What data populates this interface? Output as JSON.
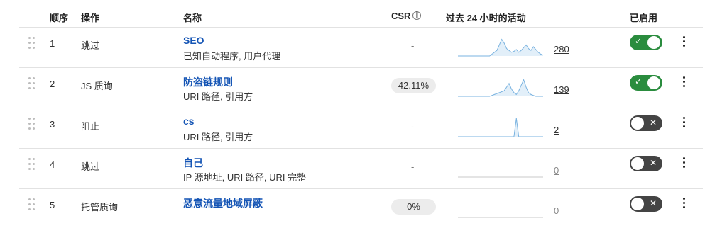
{
  "header": {
    "order": "顺序",
    "action": "操作",
    "name": "名称",
    "csr": "CSR",
    "csr_info_icon": "info-icon",
    "activity": "过去 24 小时的活动",
    "enabled": "已启用"
  },
  "colors": {
    "link": "#1555b5",
    "toggle_on": "#2a8c3e",
    "toggle_off": "#444444",
    "spark": "#7ab3e0"
  },
  "rows": [
    {
      "order": "1",
      "action": "跳过",
      "name": "SEO",
      "subtitle": "已知自动程序, 用户代理",
      "csr": "-",
      "csr_pill": false,
      "count": "280",
      "count_muted": false,
      "enabled": true,
      "enabled_mark": "✓",
      "activity": [
        0,
        0,
        0,
        0,
        0,
        0,
        0,
        0,
        0,
        0,
        0,
        0,
        0,
        0,
        0.1,
        0.2,
        0.3,
        0.6,
        0.9,
        0.7,
        0.4,
        0.3,
        0.2,
        0.25,
        0.35,
        0.2,
        0.3,
        0.45,
        0.6,
        0.4,
        0.3,
        0.5,
        0.35,
        0.2,
        0.1,
        0.05
      ]
    },
    {
      "order": "2",
      "action": "JS 质询",
      "name": "防盗链规则",
      "subtitle": "URI 路径, 引用方",
      "csr": "42.11%",
      "csr_pill": true,
      "count": "139",
      "count_muted": false,
      "enabled": true,
      "enabled_mark": "✓",
      "activity": [
        0,
        0,
        0,
        0,
        0,
        0,
        0,
        0,
        0,
        0,
        0,
        0,
        0,
        0,
        0.05,
        0.1,
        0.15,
        0.2,
        0.25,
        0.3,
        0.5,
        0.7,
        0.4,
        0.2,
        0.1,
        0.3,
        0.6,
        0.9,
        0.5,
        0.2,
        0.1,
        0.05,
        0,
        0,
        0,
        0
      ]
    },
    {
      "order": "3",
      "action": "阻止",
      "name": "cs",
      "subtitle": "URI 路径, 引用方",
      "csr": "-",
      "csr_pill": false,
      "count": "2",
      "count_muted": false,
      "enabled": false,
      "enabled_mark": "✕",
      "activity": [
        0,
        0,
        0,
        0,
        0,
        0,
        0,
        0,
        0,
        0,
        0,
        0,
        0,
        0,
        0,
        0,
        0,
        0,
        0,
        0,
        0,
        0,
        0,
        0,
        1,
        0,
        0,
        0,
        0,
        0,
        0,
        0,
        0,
        0,
        0,
        0
      ]
    },
    {
      "order": "4",
      "action": "跳过",
      "name": "自己",
      "subtitle": "IP 源地址, URI 路径, URI 完整",
      "csr": "-",
      "csr_pill": false,
      "count": "0",
      "count_muted": true,
      "enabled": false,
      "enabled_mark": "✕",
      "activity": [
        0,
        0,
        0,
        0,
        0,
        0,
        0,
        0,
        0,
        0,
        0,
        0,
        0,
        0,
        0,
        0,
        0,
        0,
        0,
        0,
        0,
        0,
        0,
        0,
        0,
        0,
        0,
        0,
        0,
        0,
        0,
        0,
        0,
        0,
        0,
        0
      ]
    },
    {
      "order": "5",
      "action": "托管质询",
      "name": "恶意流量地域屏蔽",
      "subtitle": "",
      "csr": "0%",
      "csr_pill": true,
      "count": "0",
      "count_muted": true,
      "enabled": false,
      "enabled_mark": "✕",
      "activity": [
        0,
        0,
        0,
        0,
        0,
        0,
        0,
        0,
        0,
        0,
        0,
        0,
        0,
        0,
        0,
        0,
        0,
        0,
        0,
        0,
        0,
        0,
        0,
        0,
        0,
        0,
        0,
        0,
        0,
        0,
        0,
        0,
        0,
        0,
        0,
        0
      ]
    }
  ]
}
